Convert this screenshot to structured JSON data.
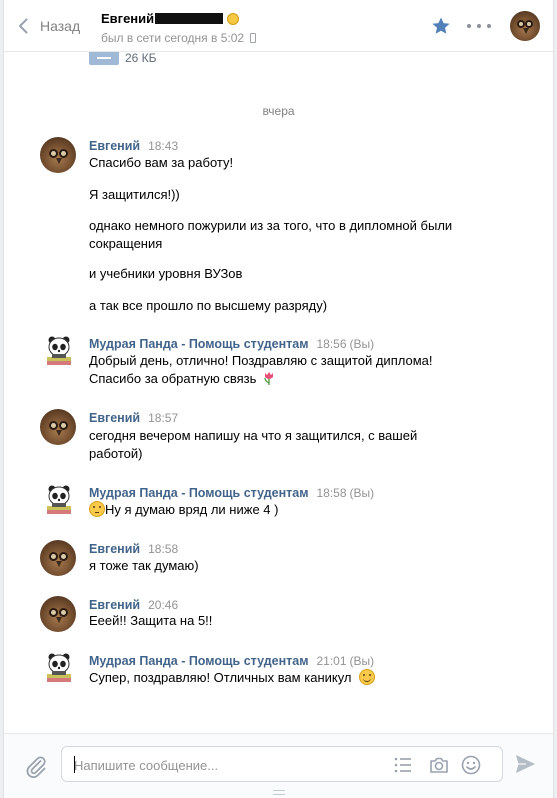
{
  "header": {
    "back_label": "Назад",
    "peer_name": "Евгений",
    "peer_status": "был в сети сегодня в 5:02",
    "star_icon": "star-icon",
    "more_icon": "more-dots-icon"
  },
  "attachment": {
    "size": "26 КБ"
  },
  "date_separator": "вчера",
  "messages": [
    {
      "author": "Евгений",
      "time": "18:43",
      "lines": [
        "Спасибо вам за работу!",
        "Я защитился!))",
        "однако немного пожурили из за того, что в дипломной были",
        "сокращения",
        "и учебники уровня ВУЗов",
        "а так все прошло по высшему разряду)"
      ]
    },
    {
      "author": "Мудрая Панда - Помощь студентам",
      "time": "18:56",
      "you": "(Вы)",
      "lines": [
        "Добрый день, отлично! Поздравляю с защитой диплома!",
        "Спасибо за обратную связь"
      ]
    },
    {
      "author": "Евгений",
      "time": "18:57",
      "lines": [
        "сегодня вечером напишу на что я защитился, с вашей",
        "работой)"
      ]
    },
    {
      "author": "Мудрая Панда - Помощь студентам",
      "time": "18:58",
      "you": "(Вы)",
      "lines": [
        "Ну я думаю вряд ли ниже 4 )"
      ]
    },
    {
      "author": "Евгений",
      "time": "18:58",
      "lines": [
        "я тоже так думаю)"
      ]
    },
    {
      "author": "Евгений",
      "time": "20:46",
      "lines": [
        "Ееей!! Защита на 5!!"
      ]
    },
    {
      "author": "Мудрая Панда - Помощь студентам",
      "time": "21:01",
      "you": "(Вы)",
      "lines": [
        "Супер, поздравляю! Отличных вам каникул"
      ]
    }
  ],
  "composer": {
    "placeholder": "Напишите сообщение..."
  },
  "colors": {
    "author_link": "#42648b",
    "accent": "#5181b8",
    "muted": "#939393"
  }
}
